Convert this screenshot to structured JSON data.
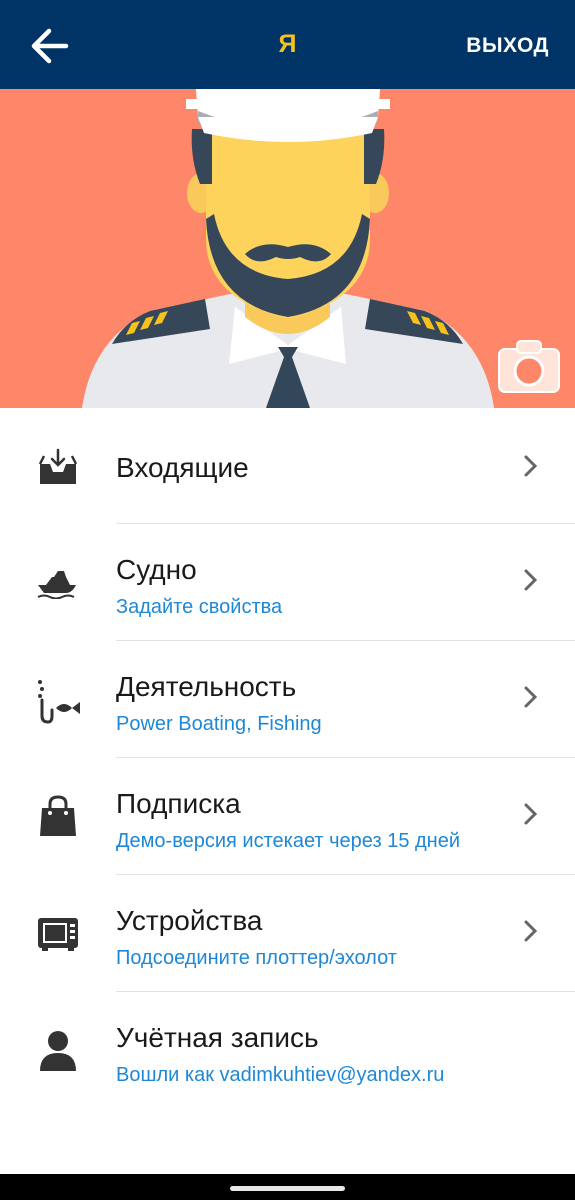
{
  "header": {
    "title": "Я",
    "logout_label": "ВЫХОД",
    "back_icon": "arrow-left-icon",
    "background": "#003366",
    "title_color": "#f5c31c"
  },
  "profile": {
    "avatar": "captain-avatar",
    "banner_color": "#ff8769",
    "camera_icon": "camera-icon"
  },
  "menu": {
    "items": [
      {
        "icon": "inbox-icon",
        "label": "Входящие",
        "sub": ""
      },
      {
        "icon": "boat-icon",
        "label": "Судно",
        "sub": "Задайте свойства"
      },
      {
        "icon": "fishing-hook-icon",
        "label": "Деятельность",
        "sub": "Power Boating, Fishing"
      },
      {
        "icon": "shopping-bag-icon",
        "label": "Подписка",
        "sub": "Демо-версия истекает через 15 дней"
      },
      {
        "icon": "device-screen-icon",
        "label": "Устройства",
        "sub": "Подсоедините плоттер/эхолот"
      },
      {
        "icon": "user-icon",
        "label": "Учётная запись",
        "sub": "Вошли как vadimkuhtiev@yandex.ru"
      }
    ],
    "accent_color": "#1e88d6"
  }
}
